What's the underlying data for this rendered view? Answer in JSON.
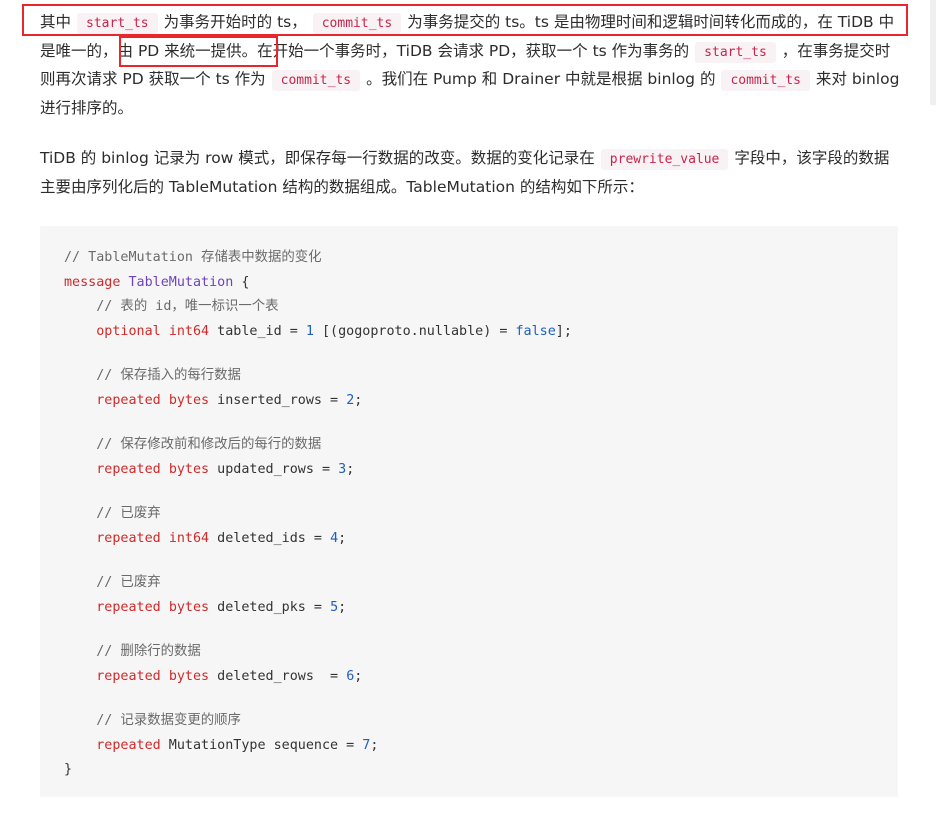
{
  "paragraph1": {
    "t1": "其中",
    "code1": "start_ts",
    "t2": "为事务开始时的 ts，",
    "code2": "commit_ts",
    "t3": "为事务提交的 ts。ts 是由物理时间和逻辑时间转化而成的，在 TiDB 中是唯一的，",
    "t4": "由 PD 来统一提供。",
    "t5": "在开始一个事务时，TiDB 会请求 PD，获取一个 ts 作为事务的",
    "code3": "start_ts",
    "t6": "，在事务提交时则再次请求 PD 获取一个 ts 作为",
    "code4": "commit_ts",
    "t7": "。我们在 Pump 和 Drainer 中就是根据 binlog 的",
    "code5": "commit_ts",
    "t8": "来对 binlog 进行排序的。"
  },
  "paragraph2": {
    "t1": "TiDB 的 binlog 记录为 row 模式，即保存每一行数据的改变。数据的变化记录在",
    "code1": "prewrite_value",
    "t2": "字段中，该字段的数据主要由序列化后的 TableMutation 结构的数据组成。TableMutation 的结构如下所示："
  },
  "colors": {
    "highlight": "#e8262b",
    "inline_code": "#c7254e",
    "code_bg": "#f6f6f6"
  },
  "code": {
    "lines": [
      [
        {
          "t": "// TableMutation 存储表中数据的变化",
          "k": "comment"
        }
      ],
      [
        {
          "t": "message ",
          "k": "keyword"
        },
        {
          "t": "TableMutation",
          "k": "classname"
        },
        {
          "t": " {",
          "k": "plain"
        }
      ],
      [
        {
          "t": "    // 表的 id，唯一标识一个表",
          "k": "comment"
        }
      ],
      [
        {
          "t": "    ",
          "k": "plain"
        },
        {
          "t": "optional",
          "k": "keyword"
        },
        {
          "t": " ",
          "k": "plain"
        },
        {
          "t": "int64",
          "k": "type"
        },
        {
          "t": " table_id = ",
          "k": "plain"
        },
        {
          "t": "1",
          "k": "number"
        },
        {
          "t": " [(gogoproto.nullable) = ",
          "k": "plain"
        },
        {
          "t": "false",
          "k": "literal"
        },
        {
          "t": "];",
          "k": "plain"
        }
      ],
      [],
      [
        {
          "t": "    // 保存插入的每行数据",
          "k": "comment"
        }
      ],
      [
        {
          "t": "    ",
          "k": "plain"
        },
        {
          "t": "repeated",
          "k": "keyword"
        },
        {
          "t": " ",
          "k": "plain"
        },
        {
          "t": "bytes",
          "k": "type"
        },
        {
          "t": " inserted_rows = ",
          "k": "plain"
        },
        {
          "t": "2",
          "k": "number"
        },
        {
          "t": ";",
          "k": "plain"
        }
      ],
      [],
      [
        {
          "t": "    // 保存修改前和修改后的每行的数据",
          "k": "comment"
        }
      ],
      [
        {
          "t": "    ",
          "k": "plain"
        },
        {
          "t": "repeated",
          "k": "keyword"
        },
        {
          "t": " ",
          "k": "plain"
        },
        {
          "t": "bytes",
          "k": "type"
        },
        {
          "t": " updated_rows = ",
          "k": "plain"
        },
        {
          "t": "3",
          "k": "number"
        },
        {
          "t": ";",
          "k": "plain"
        }
      ],
      [],
      [
        {
          "t": "    // 已废弃",
          "k": "comment"
        }
      ],
      [
        {
          "t": "    ",
          "k": "plain"
        },
        {
          "t": "repeated",
          "k": "keyword"
        },
        {
          "t": " ",
          "k": "plain"
        },
        {
          "t": "int64",
          "k": "type"
        },
        {
          "t": " deleted_ids = ",
          "k": "plain"
        },
        {
          "t": "4",
          "k": "number"
        },
        {
          "t": ";",
          "k": "plain"
        }
      ],
      [],
      [
        {
          "t": "    // 已废弃",
          "k": "comment"
        }
      ],
      [
        {
          "t": "    ",
          "k": "plain"
        },
        {
          "t": "repeated",
          "k": "keyword"
        },
        {
          "t": " ",
          "k": "plain"
        },
        {
          "t": "bytes",
          "k": "type"
        },
        {
          "t": " deleted_pks = ",
          "k": "plain"
        },
        {
          "t": "5",
          "k": "number"
        },
        {
          "t": ";",
          "k": "plain"
        }
      ],
      [],
      [
        {
          "t": "    // 删除行的数据",
          "k": "comment"
        }
      ],
      [
        {
          "t": "    ",
          "k": "plain"
        },
        {
          "t": "repeated",
          "k": "keyword"
        },
        {
          "t": " ",
          "k": "plain"
        },
        {
          "t": "bytes",
          "k": "type"
        },
        {
          "t": " deleted_rows  = ",
          "k": "plain"
        },
        {
          "t": "6",
          "k": "number"
        },
        {
          "t": ";",
          "k": "plain"
        }
      ],
      [],
      [
        {
          "t": "    // 记录数据变更的顺序",
          "k": "comment"
        }
      ],
      [
        {
          "t": "    ",
          "k": "plain"
        },
        {
          "t": "repeated",
          "k": "keyword"
        },
        {
          "t": " MutationType sequence = ",
          "k": "plain"
        },
        {
          "t": "7",
          "k": "number"
        },
        {
          "t": ";",
          "k": "plain"
        }
      ],
      [
        {
          "t": "}",
          "k": "plain"
        }
      ]
    ]
  }
}
